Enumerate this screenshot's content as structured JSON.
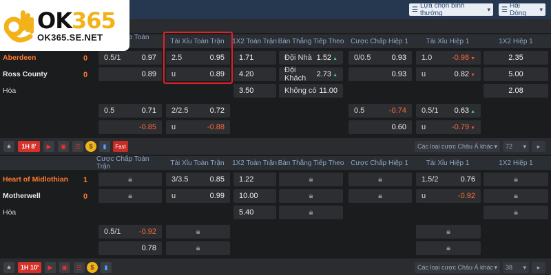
{
  "logo": {
    "brand_ok": "OK",
    "brand_num": "365",
    "domain": "OK365.SE.NET"
  },
  "topbar": {
    "display_mode": "Lựa chọn bình thường",
    "sort": "Hai Dòng"
  },
  "columns": [
    "Cược Chấp Toàn Trận",
    "Tài Xỉu Toàn Trận",
    "1X2 Toàn Trận",
    "Bàn Thắng Tiếp Theo",
    "Cược Chấp Hiệp 1",
    "Tài Xỉu Hiệp 1",
    "1X2 Hiệp 1"
  ],
  "match1": {
    "home": "Aberdeen",
    "home_score": "0",
    "away": "Ross County",
    "away_score": "0",
    "draw": "Hòa",
    "ah": {
      "line": "0.5/1",
      "home": "0.97",
      "away": "0.89"
    },
    "ou": {
      "line": "2.5",
      "over": "0.95",
      "under_label": "u",
      "under": "0.89"
    },
    "x12": {
      "home": "1.71",
      "away": "4.20",
      "draw": "3.50"
    },
    "next_goal": [
      {
        "label": "Đội Nhà",
        "value": "1.52"
      },
      {
        "label": "Đội Khách",
        "value": "2.73"
      },
      {
        "label": "Không có",
        "value": "11.00"
      }
    ],
    "ah1": {
      "line": "0/0.5",
      "home": "0.93",
      "away": "0.93"
    },
    "ou1": {
      "line": "1.0",
      "over": "-0.98",
      "under_label": "u",
      "under": "0.82"
    },
    "x121": {
      "home": "2.35",
      "away": "5.00",
      "draw": "2.08"
    },
    "alt": {
      "ah": {
        "line": "0.5",
        "home": "0.71",
        "away": "-0.85"
      },
      "ou": {
        "line": "2/2.5",
        "over": "0.72",
        "under_label": "u",
        "under": "-0.88"
      },
      "ah1": {
        "line": "0.5",
        "home": "-0.74",
        "away": "0.60"
      },
      "ou1": {
        "line": "0.5/1",
        "over": "0.63",
        "under_label": "u",
        "under": "-0.79"
      }
    },
    "toolbar": {
      "time": "1H  8'",
      "fast": "Fast",
      "market": "Các loại cược Châu Á khác",
      "count": "72"
    }
  },
  "match2": {
    "home": "Heart of Midlothian",
    "home_score": "1",
    "away": "Motherwell",
    "away_score": "0",
    "draw": "Hòa",
    "ou": {
      "line": "3/3.5",
      "over": "0.85",
      "under_label": "u",
      "under": "0.99"
    },
    "x12": {
      "home": "1.22",
      "away": "10.00",
      "draw": "5.40"
    },
    "ou1": {
      "line": "1.5/2",
      "over": "0.76",
      "under_label": "u",
      "under": "-0.92"
    },
    "alt": {
      "ah": {
        "line": "0.5/1",
        "home": "-0.92",
        "away": "0.78"
      }
    },
    "toolbar": {
      "time": "1H  10'",
      "market": "Các loại cược Châu Á khác",
      "count": "38"
    }
  }
}
